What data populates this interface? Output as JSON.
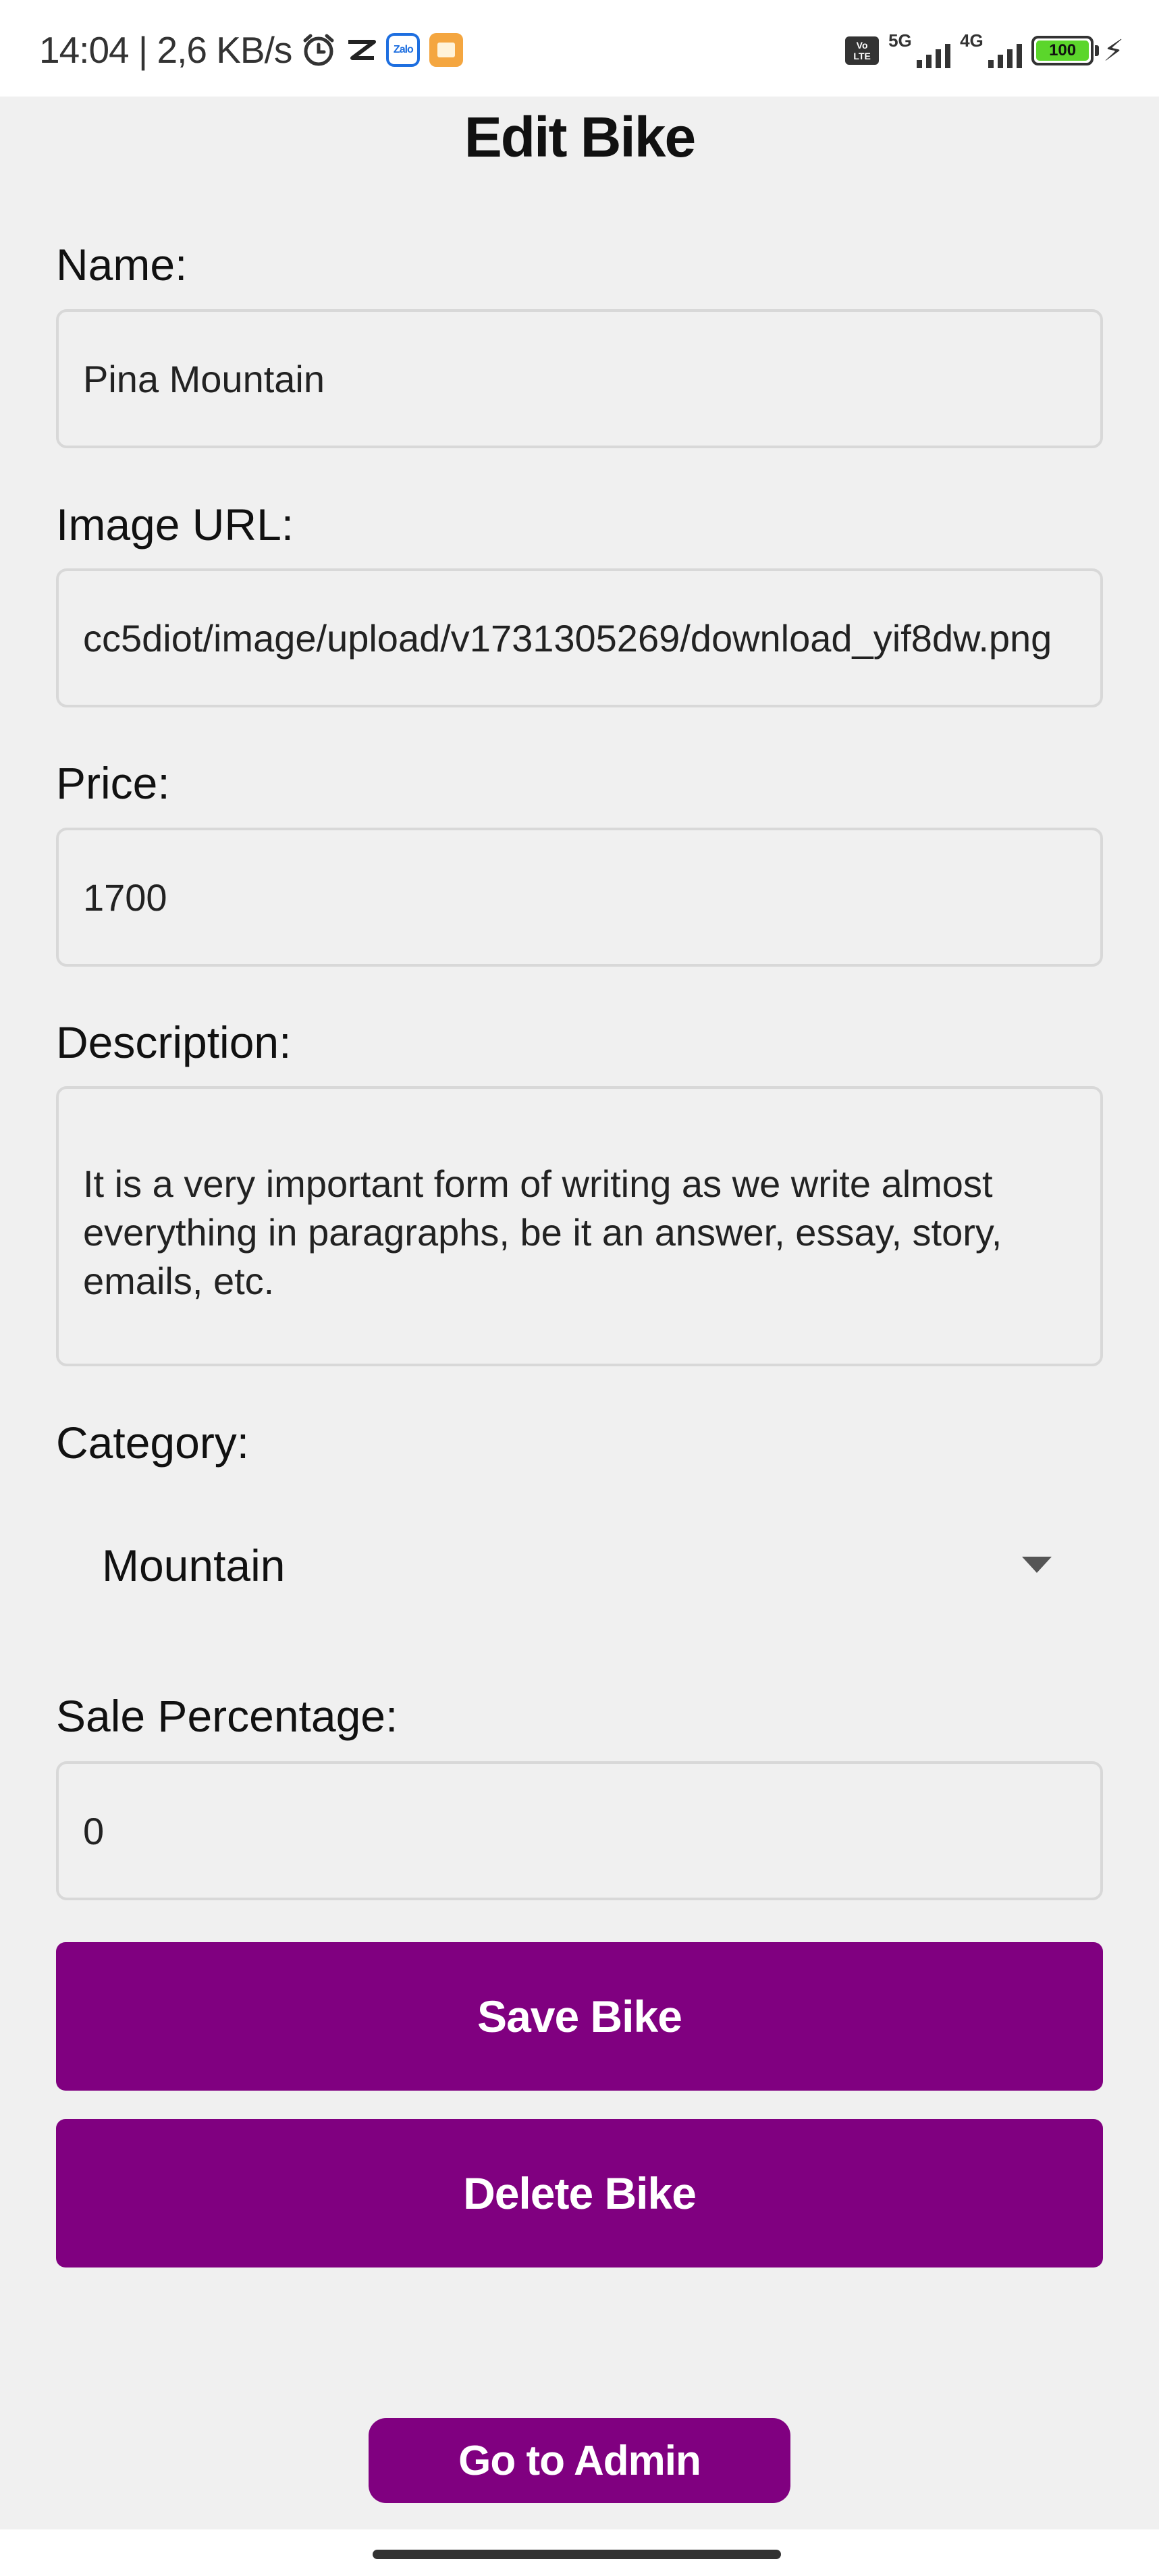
{
  "status_bar": {
    "time_speed": "14:04 | 2,6 KB/s",
    "icons": [
      "alarm-icon",
      "capcut-icon",
      "zalo-icon",
      "notes-icon"
    ],
    "zalo_label": "Zalo",
    "volte_label_1": "Vo",
    "volte_label_2": "LTE",
    "net1": "5G",
    "net2": "4G",
    "battery": "100"
  },
  "page": {
    "title": "Edit Bike"
  },
  "form": {
    "name_label": "Name:",
    "name_value": "Pina Mountain",
    "image_label": "Image URL:",
    "image_value": "cc5diot/image/upload/v1731305269/download_yif8dw.png",
    "price_label": "Price:",
    "price_value": "1700",
    "description_label": "Description:",
    "description_value": "It is a very important form of writing as we write almost everything in paragraphs, be it an answer, essay, story, emails, etc.",
    "category_label": "Category:",
    "category_value": "Mountain",
    "sale_label": "Sale Percentage:",
    "sale_value": "0"
  },
  "buttons": {
    "save": "Save Bike",
    "delete": "Delete Bike",
    "admin": "Go to Admin"
  },
  "colors": {
    "accent": "#800080",
    "background": "#f0f0f0",
    "border": "#d8d8d8"
  }
}
